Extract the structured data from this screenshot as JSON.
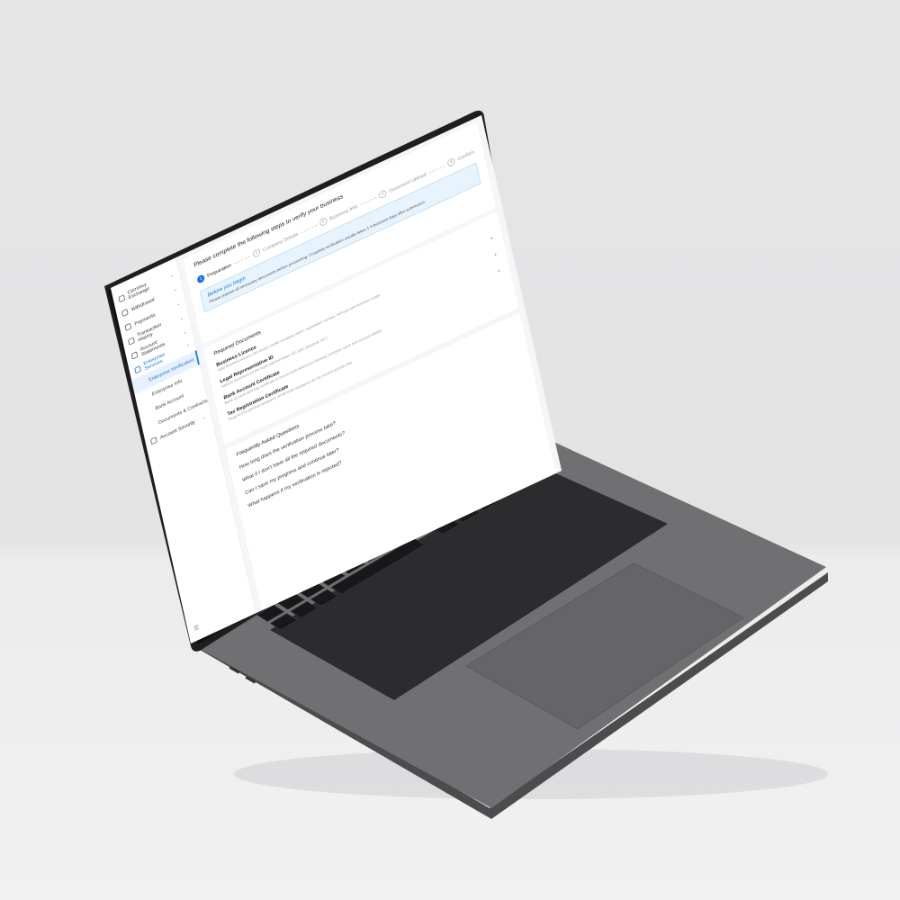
{
  "sidebar": {
    "items": [
      {
        "label": "Currency Exchange",
        "icon": "exchange-icon",
        "has_children": true
      },
      {
        "label": "Withdrawal",
        "icon": "withdraw-icon",
        "has_children": true
      },
      {
        "label": "Payments",
        "icon": "payments-icon",
        "has_children": true
      },
      {
        "label": "Transaction History",
        "icon": "history-icon",
        "has_children": true
      },
      {
        "label": "Account Statements",
        "icon": "statements-icon",
        "has_children": true
      },
      {
        "label": "Enterprise Services",
        "icon": "enterprise-icon",
        "has_children": true,
        "active": true
      }
    ],
    "enterprise_children": [
      {
        "label": "Enterprise Verification",
        "selected": true
      },
      {
        "label": "Enterprise Info"
      },
      {
        "label": "Bank Account"
      },
      {
        "label": "Documents & Contracts"
      }
    ],
    "security": {
      "label": "Account Security",
      "icon": "security-icon"
    },
    "footer_icon": "menu-collapse-icon"
  },
  "page": {
    "title": "Please complete the following steps to verify your business",
    "steps": [
      {
        "num": "1",
        "label": "Preparation",
        "current": true
      },
      {
        "num": "2",
        "label": "Company Details"
      },
      {
        "num": "3",
        "label": "Business Info"
      },
      {
        "num": "4",
        "label": "Document Upload"
      },
      {
        "num": "5",
        "label": "Confirm"
      }
    ],
    "notice": {
      "title": "Before you begin",
      "text": "Please prepare all necessary documents before proceeding. Complete verification usually takes 1-3 business days after submission."
    }
  },
  "documents": {
    "title": "Required Documents",
    "items": [
      {
        "name": "Business Licence",
        "desc": "Valid business licence with clearly visible company name, registration number, address and business scope"
      },
      {
        "name": "Legal Representative ID",
        "desc": "Valid ID document for the legal representative (ID card, passport, etc.)"
      },
      {
        "name": "Bank Account Certificate",
        "desc": "Bank account opening certificate or recent bank statement showing company name and account details"
      },
      {
        "name": "Tax Registration Certificate",
        "desc": "Required for general taxpayers; small-scale taxpayers do not need to provide this"
      }
    ],
    "add_symbol": "+"
  },
  "faq": {
    "title": "Frequently Asked Questions",
    "questions": [
      "How long does the verification process take?",
      "What if I don't have all the required documents?",
      "Can I save my progress and continue later?",
      "What happens if my verification is rejected?"
    ]
  },
  "colors": {
    "accent": "#1a73e8",
    "notice_bg": "#e8f4fd",
    "laptop_body": "#6b6b6d",
    "key": "#1c1c1e"
  }
}
